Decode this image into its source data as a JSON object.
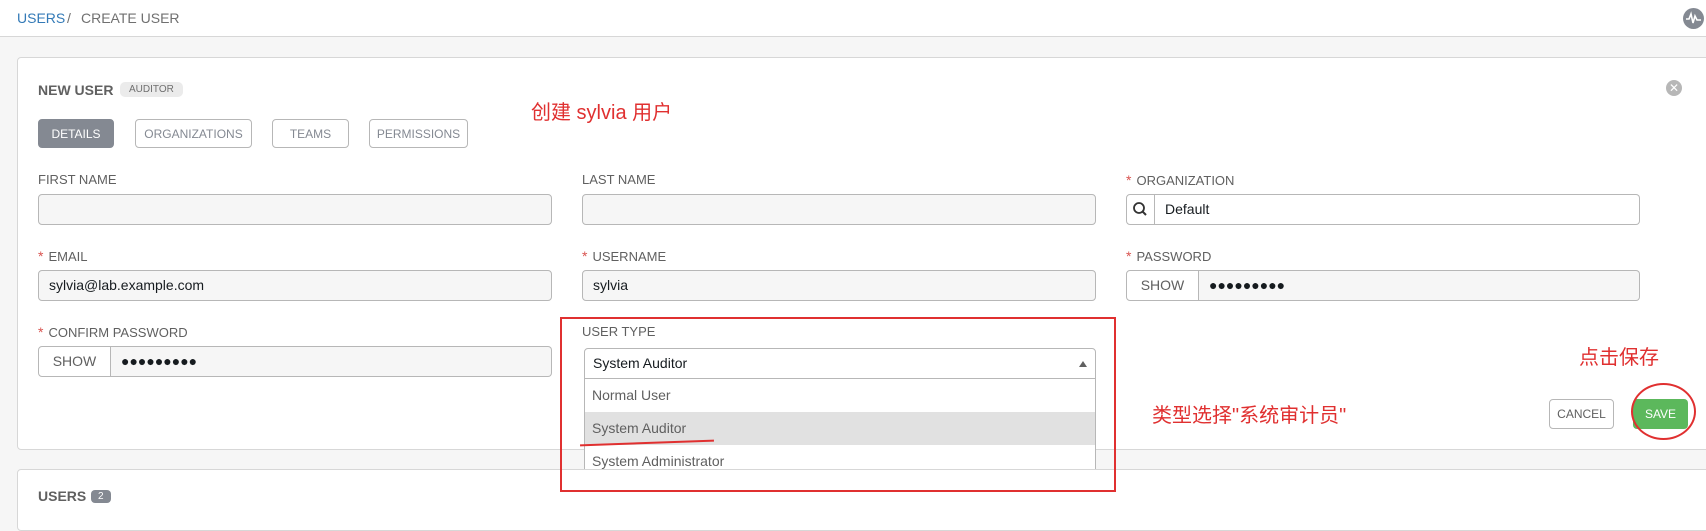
{
  "breadcrumb": {
    "root": "USERS",
    "separator": "/",
    "current": "CREATE USER"
  },
  "header_icon": "activity-icon",
  "form": {
    "title": "NEW USER",
    "badge": "AUDITOR",
    "tabs": [
      {
        "label": "DETAILS",
        "active": true
      },
      {
        "label": "ORGANIZATIONS",
        "active": false
      },
      {
        "label": "TEAMS",
        "active": false
      },
      {
        "label": "PERMISSIONS",
        "active": false
      }
    ],
    "fields": {
      "first_name": {
        "label": "FIRST NAME",
        "value": ""
      },
      "last_name": {
        "label": "LAST NAME",
        "value": ""
      },
      "organization": {
        "label": "ORGANIZATION",
        "value": "Default",
        "required": true
      },
      "email": {
        "label": "EMAIL",
        "value": "sylvia@lab.example.com",
        "required": true
      },
      "username": {
        "label": "USERNAME",
        "value": "sylvia",
        "required": true
      },
      "password": {
        "label": "PASSWORD",
        "show_label": "SHOW",
        "value": "●●●●●●●●●",
        "required": true
      },
      "confirm_password": {
        "label": "CONFIRM PASSWORD",
        "show_label": "SHOW",
        "value": "●●●●●●●●●",
        "required": true
      },
      "user_type": {
        "label": "USER TYPE",
        "selected": "System Auditor",
        "options": [
          "Normal User",
          "System Auditor",
          "System Administrator"
        ]
      }
    },
    "required_mark": "*",
    "buttons": {
      "cancel": "CANCEL",
      "save": "SAVE"
    }
  },
  "users_panel": {
    "title": "USERS",
    "count": "2"
  },
  "annotations": {
    "create_user": "创建 sylvia 用户",
    "select_type": "类型选择\"系统审计员\"",
    "click_save": "点击保存"
  },
  "colors": {
    "link": "#337ab7",
    "save": "#5cb85c",
    "annotation": "#e03030",
    "tab_active": "#848992"
  }
}
